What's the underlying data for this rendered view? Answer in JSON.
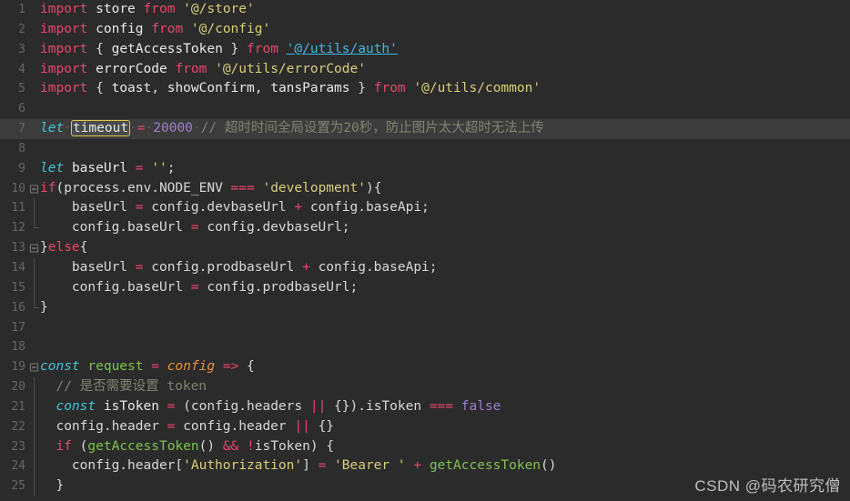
{
  "editor": {
    "theme_name": "darcula",
    "background": "#2b2b2b",
    "gutter_color": "#636569",
    "current_line_highlight": "#3c3c3c",
    "occurrence_border": "#d9c84a",
    "language": "javascript"
  },
  "watermark": {
    "text": "CSDN @码农研究僧"
  },
  "lines": [
    {
      "n": "1",
      "fold": false,
      "guide": "none",
      "highlight": false
    },
    {
      "n": "2",
      "fold": false,
      "guide": "none",
      "highlight": false
    },
    {
      "n": "3",
      "fold": false,
      "guide": "none",
      "highlight": false
    },
    {
      "n": "4",
      "fold": false,
      "guide": "none",
      "highlight": false
    },
    {
      "n": "5",
      "fold": false,
      "guide": "none",
      "highlight": false
    },
    {
      "n": "6",
      "fold": false,
      "guide": "none",
      "highlight": false
    },
    {
      "n": "7",
      "fold": false,
      "guide": "none",
      "highlight": true
    },
    {
      "n": "8",
      "fold": false,
      "guide": "none",
      "highlight": false
    },
    {
      "n": "9",
      "fold": false,
      "guide": "none",
      "highlight": false
    },
    {
      "n": "10",
      "fold": true,
      "guide": "none",
      "highlight": false
    },
    {
      "n": "11",
      "fold": false,
      "guide": "full",
      "highlight": false
    },
    {
      "n": "12",
      "fold": false,
      "guide": "end",
      "highlight": false
    },
    {
      "n": "13",
      "fold": true,
      "guide": "none",
      "highlight": false
    },
    {
      "n": "14",
      "fold": false,
      "guide": "full",
      "highlight": false
    },
    {
      "n": "15",
      "fold": false,
      "guide": "full",
      "highlight": false
    },
    {
      "n": "16",
      "fold": false,
      "guide": "end",
      "highlight": false
    },
    {
      "n": "17",
      "fold": false,
      "guide": "none",
      "highlight": false
    },
    {
      "n": "18",
      "fold": false,
      "guide": "none",
      "highlight": false
    },
    {
      "n": "19",
      "fold": true,
      "guide": "none",
      "highlight": false
    },
    {
      "n": "20",
      "fold": false,
      "guide": "full",
      "highlight": false
    },
    {
      "n": "21",
      "fold": false,
      "guide": "full",
      "highlight": false
    },
    {
      "n": "22",
      "fold": false,
      "guide": "full",
      "highlight": false
    },
    {
      "n": "23",
      "fold": false,
      "guide": "full",
      "highlight": false
    },
    {
      "n": "24",
      "fold": false,
      "guide": "full",
      "highlight": false
    },
    {
      "n": "25",
      "fold": false,
      "guide": "full",
      "highlight": false
    }
  ],
  "code": {
    "l1": "import store from '@/store'",
    "l2": "import config from '@/config'",
    "l3": "import { getAccessToken } from '@/utils/auth'",
    "l4": "import errorCode from '@/utils/errorCode'",
    "l5": "import { toast, showConfirm, tansParams } from '@/utils/common'",
    "l6": "",
    "l7": "let timeout = 20000 // 超时时间全局设置为20秒，防止图片太大超时无法上传",
    "l8": "",
    "l9": "let baseUrl = '';",
    "l10": "if(process.env.NODE_ENV === 'development'){",
    "l11": "    baseUrl = config.devbaseUrl + config.baseApi;",
    "l12": "    config.baseUrl = config.devbaseUrl;",
    "l13": "}else{",
    "l14": "    baseUrl = config.prodbaseUrl + config.baseApi;",
    "l15": "    config.baseUrl = config.prodbaseUrl;",
    "l16": "}",
    "l17": "",
    "l18": "",
    "l19": "const request = config => {",
    "l20": "  // 是否需要设置 token",
    "l21": "  const isToken = (config.headers || {}).isToken === false",
    "l22": "  config.header = config.header || {}",
    "l23": "  if (getAccessToken() && !isToken) {",
    "l24": "    config.header['Authorization'] = 'Bearer ' + getAccessToken()",
    "l25": "  }"
  },
  "tokens": {
    "import": "import",
    "from": "from",
    "let": "let",
    "const": "const",
    "if": "if",
    "else": "else",
    "false": "false",
    "store": "store",
    "config": "config",
    "errorCode": "errorCode",
    "getAccessToken": "getAccessToken",
    "toast": "toast",
    "showConfirm": "showConfirm",
    "tansParams": "tansParams",
    "timeout": "timeout",
    "timeout_value": "20000",
    "baseUrl": "baseUrl",
    "request": "request",
    "isToken": "isToken",
    "str_store": "'@/store'",
    "str_config": "'@/config'",
    "str_auth": "'@/utils/auth'",
    "str_errorCode": "'@/utils/errorCode'",
    "str_common": "'@/utils/common'",
    "str_empty": "''",
    "str_development": "'development'",
    "str_authorization": "'Authorization'",
    "str_bearer": "'Bearer '",
    "comment_timeout": "// 超时时间全局设置为20秒，防止图片太大超时无法上传",
    "comment_token": "// 是否需要设置 token"
  }
}
